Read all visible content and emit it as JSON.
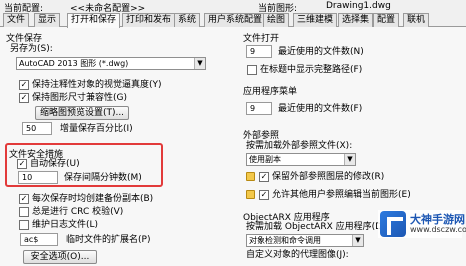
{
  "header": {
    "current_profile_label": "当前配置:",
    "current_profile_value": "<<未命名配置>>",
    "current_drawing_label": "当前图形:",
    "current_drawing_value": "Drawing1.dwg"
  },
  "tabs": [
    "文件",
    "显示",
    "打开和保存",
    "打印和发布",
    "系统",
    "用户系统配置",
    "绘图",
    "三维建模",
    "选择集",
    "配置",
    "联机"
  ],
  "active_tab": "打开和保存",
  "file_save": {
    "title": "文件保存",
    "save_as_label": "另存为(S):",
    "save_as_value": "AutoCAD 2013 图形 (*.dwg)",
    "keep_annotative": "保持注释性对象的视觉逼真度(Y)",
    "keep_drawing_size": "保持图形尺寸兼容性(G)",
    "thumbnail_button": "缩略图预览设置(T)...",
    "incremental_value": "50",
    "incremental_label": "增量保存百分比(I)"
  },
  "file_safety": {
    "title": "文件安全措施",
    "autosave_label": "自动保存(U)",
    "autosave_checked": true,
    "minutes_value": "10",
    "minutes_label": "保存间隔分钟数(M)",
    "backup_label": "每次保存时均创建备份副本(B)",
    "backup_checked": true,
    "crc_label": "总是进行 CRC 校验(V)",
    "crc_checked": false,
    "log_label": "维护日志文件(L)",
    "log_checked": false,
    "ext_value": "ac$",
    "ext_label": "临时文件的扩展名(P)",
    "security_button": "安全选项(O)..."
  },
  "file_open": {
    "title": "文件打开",
    "recent_value": "9",
    "recent_label": "最近使用的文件数(N)",
    "fullpath_label": "在标题中显示完整路径(F)",
    "fullpath_checked": false
  },
  "app_menu": {
    "title": "应用程序菜单",
    "recent_value": "9",
    "recent_label": "最近使用的文件数(F)"
  },
  "xref": {
    "title": "外部参照",
    "demand_label": "按需加载外部参照文件(X):",
    "demand_value": "使用副本",
    "retain_label": "保留外部参照图层的修改(R)",
    "retain_checked": true,
    "allow_edit_label": "允许其他用户参照编辑当前图形(E)",
    "allow_edit_checked": true
  },
  "objectarx": {
    "title": "ObjectARX 应用程序",
    "demand_label": "按需加载 ObjectARX 应用程序(D):",
    "demand_value": "对象检测和命令调用",
    "proxy_label": "自定义对象的代理图像(J):"
  },
  "watermark": {
    "title": "大神手游网",
    "subtitle": "www.dsczw.com"
  }
}
